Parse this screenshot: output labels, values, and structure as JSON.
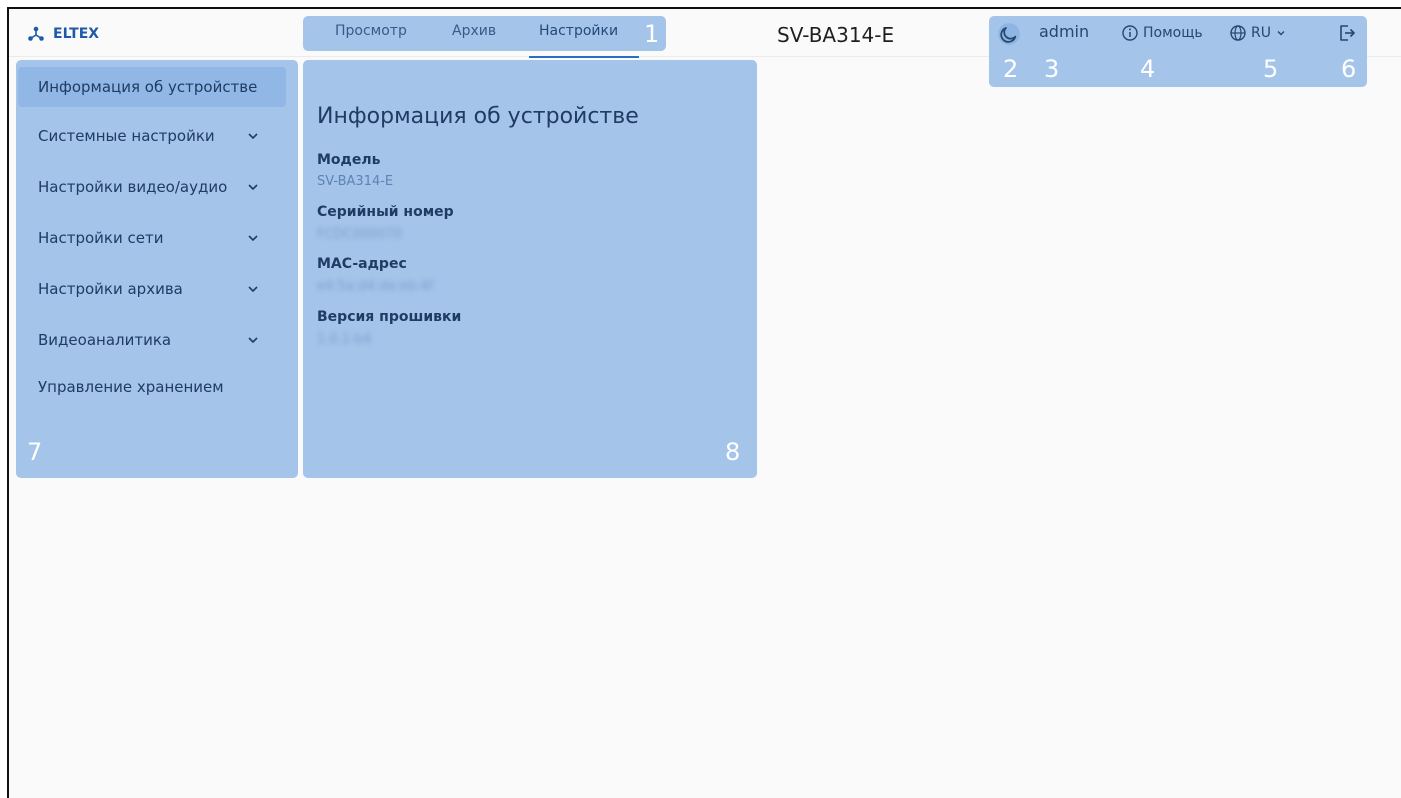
{
  "brand": {
    "name": "ELTEX"
  },
  "nav": {
    "tabs": [
      {
        "label": "Просмотр"
      },
      {
        "label": "Архив"
      },
      {
        "label": "Настройки",
        "active": true
      }
    ]
  },
  "header": {
    "device_name": "SV-BA314-E",
    "user": "admin",
    "help_label": "Помощь",
    "language": "RU"
  },
  "overlay_numbers": [
    "1",
    "2",
    "3",
    "4",
    "5",
    "6",
    "7",
    "8"
  ],
  "sidebar": {
    "items": [
      {
        "label": "Информация об устройстве",
        "active": true,
        "expandable": false
      },
      {
        "label": "Системные настройки",
        "expandable": true
      },
      {
        "label": "Настройки видео/аудио",
        "expandable": true
      },
      {
        "label": "Настройки сети",
        "expandable": true
      },
      {
        "label": "Настройки архива",
        "expandable": true
      },
      {
        "label": "Видеоаналитика",
        "expandable": true
      },
      {
        "label": "Управление хранением",
        "expandable": false
      }
    ]
  },
  "device_info": {
    "title": "Информация об устройстве",
    "fields": [
      {
        "label": "Модель",
        "value": "SV-BA314-E"
      },
      {
        "label": "Серийный номер",
        "value": "FCDC000070"
      },
      {
        "label": "MAC-адрес",
        "value": "e4:5a:d4:de:eb:4f"
      },
      {
        "label": "Версия прошивки",
        "value": "1.0.1-b4"
      }
    ]
  },
  "colors": {
    "accent": "#2b6cc4",
    "overlay": "#a4c4ea",
    "active_item": "#90b7e6"
  }
}
